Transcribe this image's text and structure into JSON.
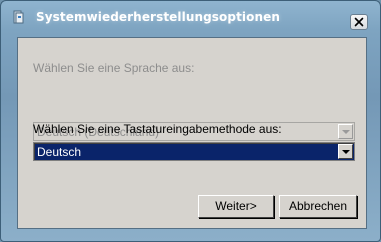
{
  "window": {
    "title": "Systemwiederherstellungsoptionen"
  },
  "titlebar_buttons": {
    "close_icon": "close-icon"
  },
  "language": {
    "label": "Wählen Sie eine Sprache aus:",
    "selected": "Deutsch (Deutschland)",
    "enabled": false
  },
  "keyboard": {
    "label": "Wählen Sie eine Tastatureingabemethode aus:",
    "selected": "Deutsch",
    "enabled": true
  },
  "buttons": {
    "next_label": "Weiter>",
    "cancel_label": "Abbrechen"
  },
  "colors": {
    "dialog_background": "#d6d3ce",
    "selection": "#0a246a",
    "frame": "#7498b6"
  }
}
